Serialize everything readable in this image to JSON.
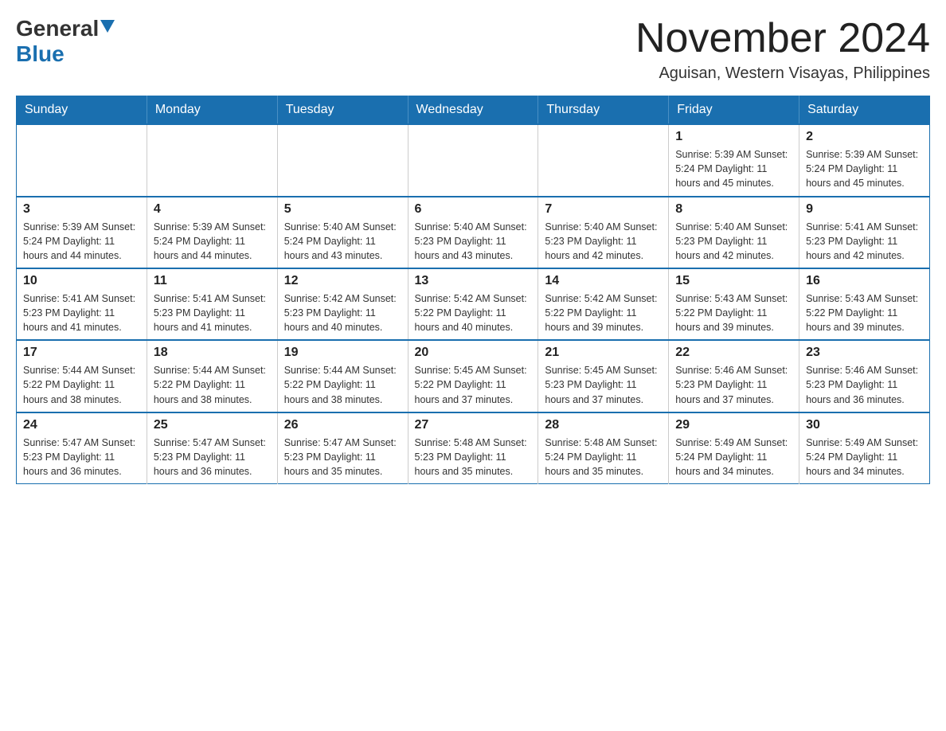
{
  "header": {
    "logo_general": "General",
    "logo_blue": "Blue",
    "title": "November 2024",
    "subtitle": "Aguisan, Western Visayas, Philippines"
  },
  "calendar": {
    "days_of_week": [
      "Sunday",
      "Monday",
      "Tuesday",
      "Wednesday",
      "Thursday",
      "Friday",
      "Saturday"
    ],
    "weeks": [
      [
        {
          "day": "",
          "info": ""
        },
        {
          "day": "",
          "info": ""
        },
        {
          "day": "",
          "info": ""
        },
        {
          "day": "",
          "info": ""
        },
        {
          "day": "",
          "info": ""
        },
        {
          "day": "1",
          "info": "Sunrise: 5:39 AM\nSunset: 5:24 PM\nDaylight: 11 hours and 45 minutes."
        },
        {
          "day": "2",
          "info": "Sunrise: 5:39 AM\nSunset: 5:24 PM\nDaylight: 11 hours and 45 minutes."
        }
      ],
      [
        {
          "day": "3",
          "info": "Sunrise: 5:39 AM\nSunset: 5:24 PM\nDaylight: 11 hours and 44 minutes."
        },
        {
          "day": "4",
          "info": "Sunrise: 5:39 AM\nSunset: 5:24 PM\nDaylight: 11 hours and 44 minutes."
        },
        {
          "day": "5",
          "info": "Sunrise: 5:40 AM\nSunset: 5:24 PM\nDaylight: 11 hours and 43 minutes."
        },
        {
          "day": "6",
          "info": "Sunrise: 5:40 AM\nSunset: 5:23 PM\nDaylight: 11 hours and 43 minutes."
        },
        {
          "day": "7",
          "info": "Sunrise: 5:40 AM\nSunset: 5:23 PM\nDaylight: 11 hours and 42 minutes."
        },
        {
          "day": "8",
          "info": "Sunrise: 5:40 AM\nSunset: 5:23 PM\nDaylight: 11 hours and 42 minutes."
        },
        {
          "day": "9",
          "info": "Sunrise: 5:41 AM\nSunset: 5:23 PM\nDaylight: 11 hours and 42 minutes."
        }
      ],
      [
        {
          "day": "10",
          "info": "Sunrise: 5:41 AM\nSunset: 5:23 PM\nDaylight: 11 hours and 41 minutes."
        },
        {
          "day": "11",
          "info": "Sunrise: 5:41 AM\nSunset: 5:23 PM\nDaylight: 11 hours and 41 minutes."
        },
        {
          "day": "12",
          "info": "Sunrise: 5:42 AM\nSunset: 5:23 PM\nDaylight: 11 hours and 40 minutes."
        },
        {
          "day": "13",
          "info": "Sunrise: 5:42 AM\nSunset: 5:22 PM\nDaylight: 11 hours and 40 minutes."
        },
        {
          "day": "14",
          "info": "Sunrise: 5:42 AM\nSunset: 5:22 PM\nDaylight: 11 hours and 39 minutes."
        },
        {
          "day": "15",
          "info": "Sunrise: 5:43 AM\nSunset: 5:22 PM\nDaylight: 11 hours and 39 minutes."
        },
        {
          "day": "16",
          "info": "Sunrise: 5:43 AM\nSunset: 5:22 PM\nDaylight: 11 hours and 39 minutes."
        }
      ],
      [
        {
          "day": "17",
          "info": "Sunrise: 5:44 AM\nSunset: 5:22 PM\nDaylight: 11 hours and 38 minutes."
        },
        {
          "day": "18",
          "info": "Sunrise: 5:44 AM\nSunset: 5:22 PM\nDaylight: 11 hours and 38 minutes."
        },
        {
          "day": "19",
          "info": "Sunrise: 5:44 AM\nSunset: 5:22 PM\nDaylight: 11 hours and 38 minutes."
        },
        {
          "day": "20",
          "info": "Sunrise: 5:45 AM\nSunset: 5:22 PM\nDaylight: 11 hours and 37 minutes."
        },
        {
          "day": "21",
          "info": "Sunrise: 5:45 AM\nSunset: 5:23 PM\nDaylight: 11 hours and 37 minutes."
        },
        {
          "day": "22",
          "info": "Sunrise: 5:46 AM\nSunset: 5:23 PM\nDaylight: 11 hours and 37 minutes."
        },
        {
          "day": "23",
          "info": "Sunrise: 5:46 AM\nSunset: 5:23 PM\nDaylight: 11 hours and 36 minutes."
        }
      ],
      [
        {
          "day": "24",
          "info": "Sunrise: 5:47 AM\nSunset: 5:23 PM\nDaylight: 11 hours and 36 minutes."
        },
        {
          "day": "25",
          "info": "Sunrise: 5:47 AM\nSunset: 5:23 PM\nDaylight: 11 hours and 36 minutes."
        },
        {
          "day": "26",
          "info": "Sunrise: 5:47 AM\nSunset: 5:23 PM\nDaylight: 11 hours and 35 minutes."
        },
        {
          "day": "27",
          "info": "Sunrise: 5:48 AM\nSunset: 5:23 PM\nDaylight: 11 hours and 35 minutes."
        },
        {
          "day": "28",
          "info": "Sunrise: 5:48 AM\nSunset: 5:24 PM\nDaylight: 11 hours and 35 minutes."
        },
        {
          "day": "29",
          "info": "Sunrise: 5:49 AM\nSunset: 5:24 PM\nDaylight: 11 hours and 34 minutes."
        },
        {
          "day": "30",
          "info": "Sunrise: 5:49 AM\nSunset: 5:24 PM\nDaylight: 11 hours and 34 minutes."
        }
      ]
    ]
  }
}
